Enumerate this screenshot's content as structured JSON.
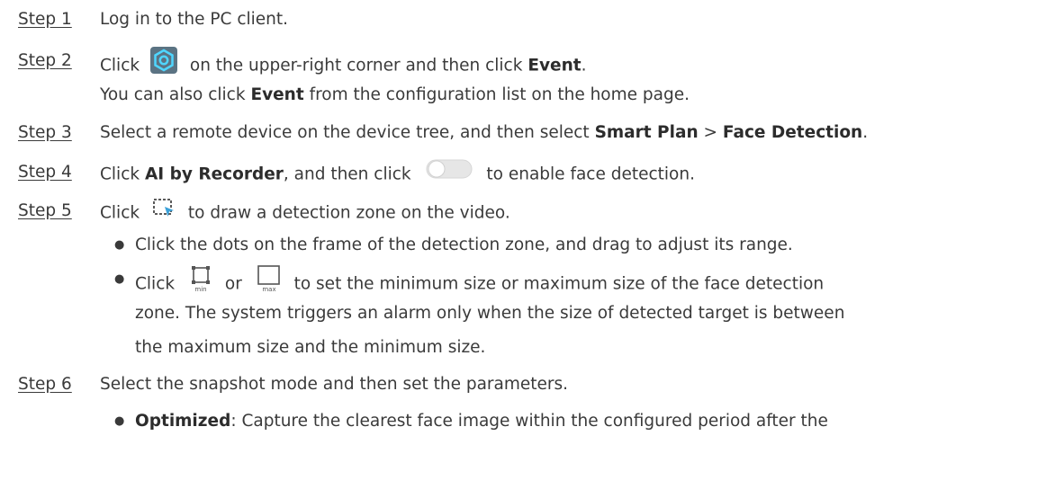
{
  "steps": [
    {
      "label": "Step 1",
      "text": "Log in to the PC client."
    },
    {
      "label": "Step 2",
      "pre": "Click",
      "post": "on the upper-right corner and then click",
      "bold": "Event",
      "end": ".",
      "note_pre": "You can also click",
      "note_bold": "Event",
      "note_post": "from the configuration list on the home page."
    },
    {
      "label": "Step 3",
      "pre": "Select a remote device on the device tree, and then select",
      "bold1": "Smart Plan",
      "sep": ">",
      "bold2": "Face Detection",
      "end": "."
    },
    {
      "label": "Step 4",
      "pre": "Click",
      "bold": "AI by Recorder",
      "mid": ", and then click",
      "post": "to enable face detection."
    },
    {
      "label": "Step 5",
      "pre": "Click",
      "post": "to draw a detection zone on the video.",
      "bullets": [
        "Click the dots on the frame of the detection zone, and drag to adjust its range.",
        {
          "pre": "Click",
          "or": "or",
          "post": "to set the minimum size or maximum size of the face detection"
        },
        "zone. The system triggers an alarm only when the size of detected target is between",
        "the maximum size and the minimum size."
      ]
    },
    {
      "label": "Step 6",
      "text": "Select the snapshot mode and then set the parameters.",
      "bullet_bold": "Optimized",
      "bullet_text": ": Capture the clearest face image within the configured period after the"
    }
  ],
  "icons": {
    "settings": "settings-gear-icon",
    "toggle": "toggle-switch-off-icon",
    "draw": "draw-zone-icon",
    "min": "min-size-icon",
    "max": "max-size-icon",
    "min_label": "min",
    "max_label": "max"
  },
  "colors": {
    "text": "#3a3a3a",
    "settings_bg": "#5b7383",
    "settings_ring": "#4fd6ff"
  }
}
